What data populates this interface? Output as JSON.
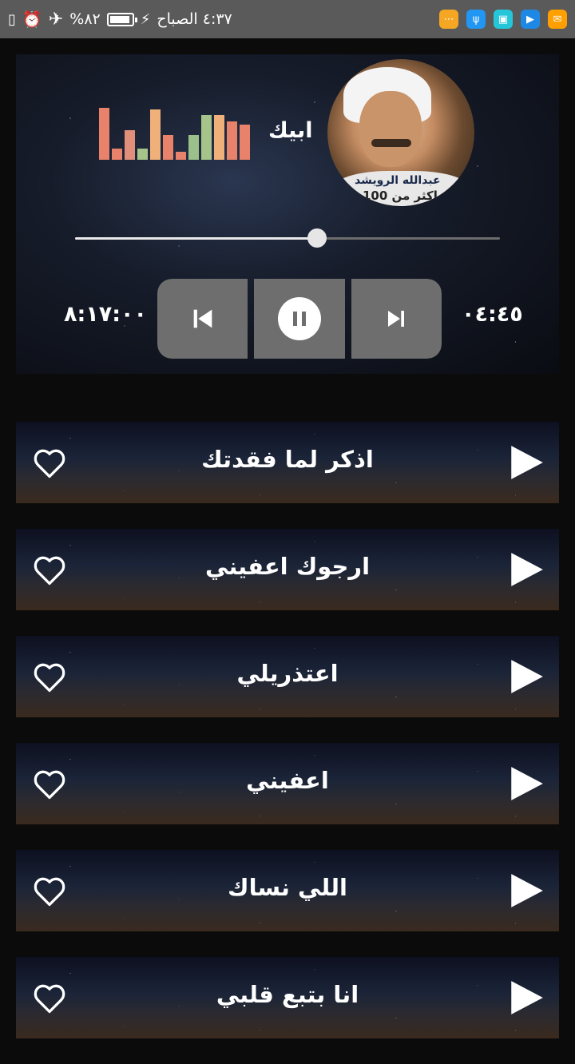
{
  "status_bar": {
    "time": "٤:٣٧ الصباح",
    "battery": "٨٢%",
    "icons": [
      "flash-icon",
      "battery-icon",
      "airplane-icon",
      "alarm-icon",
      "vibrate-icon"
    ],
    "apps": [
      {
        "name": "more-app-icon",
        "color": "#f5a623"
      },
      {
        "name": "usb-app-icon",
        "color": "#2196f3"
      },
      {
        "name": "gallery-app-icon",
        "color": "#26c6da"
      },
      {
        "name": "video-app-icon",
        "color": "#1e88e5"
      },
      {
        "name": "message-app-icon",
        "color": "#ffa000"
      }
    ]
  },
  "player": {
    "song_title": "ابيك",
    "cover_caption_1": "عبدالله الرويشد",
    "cover_caption_2": "اكثر من 100",
    "elapsed": "٠٤:٤٥",
    "duration": "٨:١٧:٠٠",
    "progress": 0.57,
    "equalizer": [
      {
        "level": 0.95,
        "color": "#e8826a"
      },
      {
        "level": 0.2,
        "color": "#e8826a"
      },
      {
        "level": 0.55,
        "color": "#e0907a"
      },
      {
        "level": 0.2,
        "color": "#a6c48a"
      },
      {
        "level": 0.92,
        "color": "#f0b07a"
      },
      {
        "level": 0.45,
        "color": "#e8826a"
      },
      {
        "level": 0.15,
        "color": "#e8826a"
      },
      {
        "level": 0.45,
        "color": "#9cc08a"
      },
      {
        "level": 0.82,
        "color": "#a6c48a"
      },
      {
        "level": 0.82,
        "color": "#f0b07a"
      },
      {
        "level": 0.7,
        "color": "#e8826a"
      },
      {
        "level": 0.65,
        "color": "#e8826a"
      }
    ]
  },
  "songs": [
    {
      "title": "اذكر لما فقدتك"
    },
    {
      "title": "ارجوك اعفيني"
    },
    {
      "title": "اعتذريلي"
    },
    {
      "title": "اعفيني"
    },
    {
      "title": "اللي نساك"
    },
    {
      "title": "انا بتبع قلبي"
    }
  ]
}
